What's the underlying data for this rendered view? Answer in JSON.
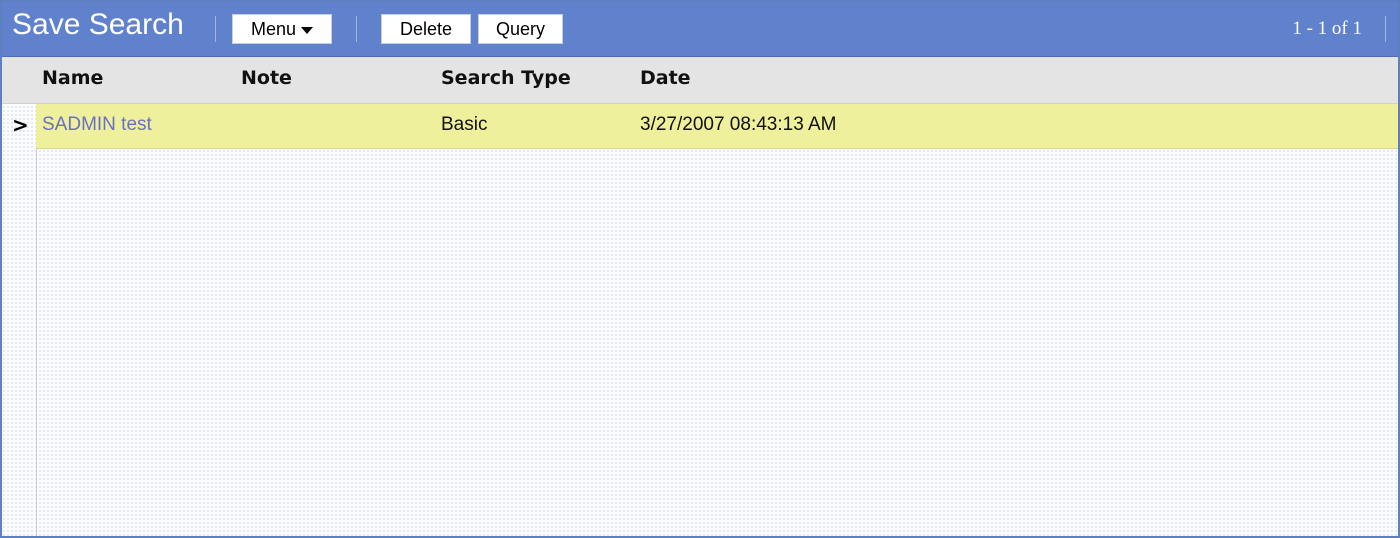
{
  "applet": {
    "title": "Save Search",
    "menu_label": "Menu",
    "delete_label": "Delete",
    "query_label": "Query",
    "pager": "1 - 1 of 1"
  },
  "table": {
    "columns": [
      "Name",
      "Note",
      "Search Type",
      "Date"
    ],
    "rows": [
      {
        "selected_marker": ">",
        "name": "SADMIN test",
        "note": "",
        "search_type": "Basic",
        "date": "3/27/2007 08:43:13 AM"
      }
    ]
  },
  "colors": {
    "titlebar": "#6082cc",
    "selected_row": "#eff09c",
    "link": "#6b6fc8"
  }
}
